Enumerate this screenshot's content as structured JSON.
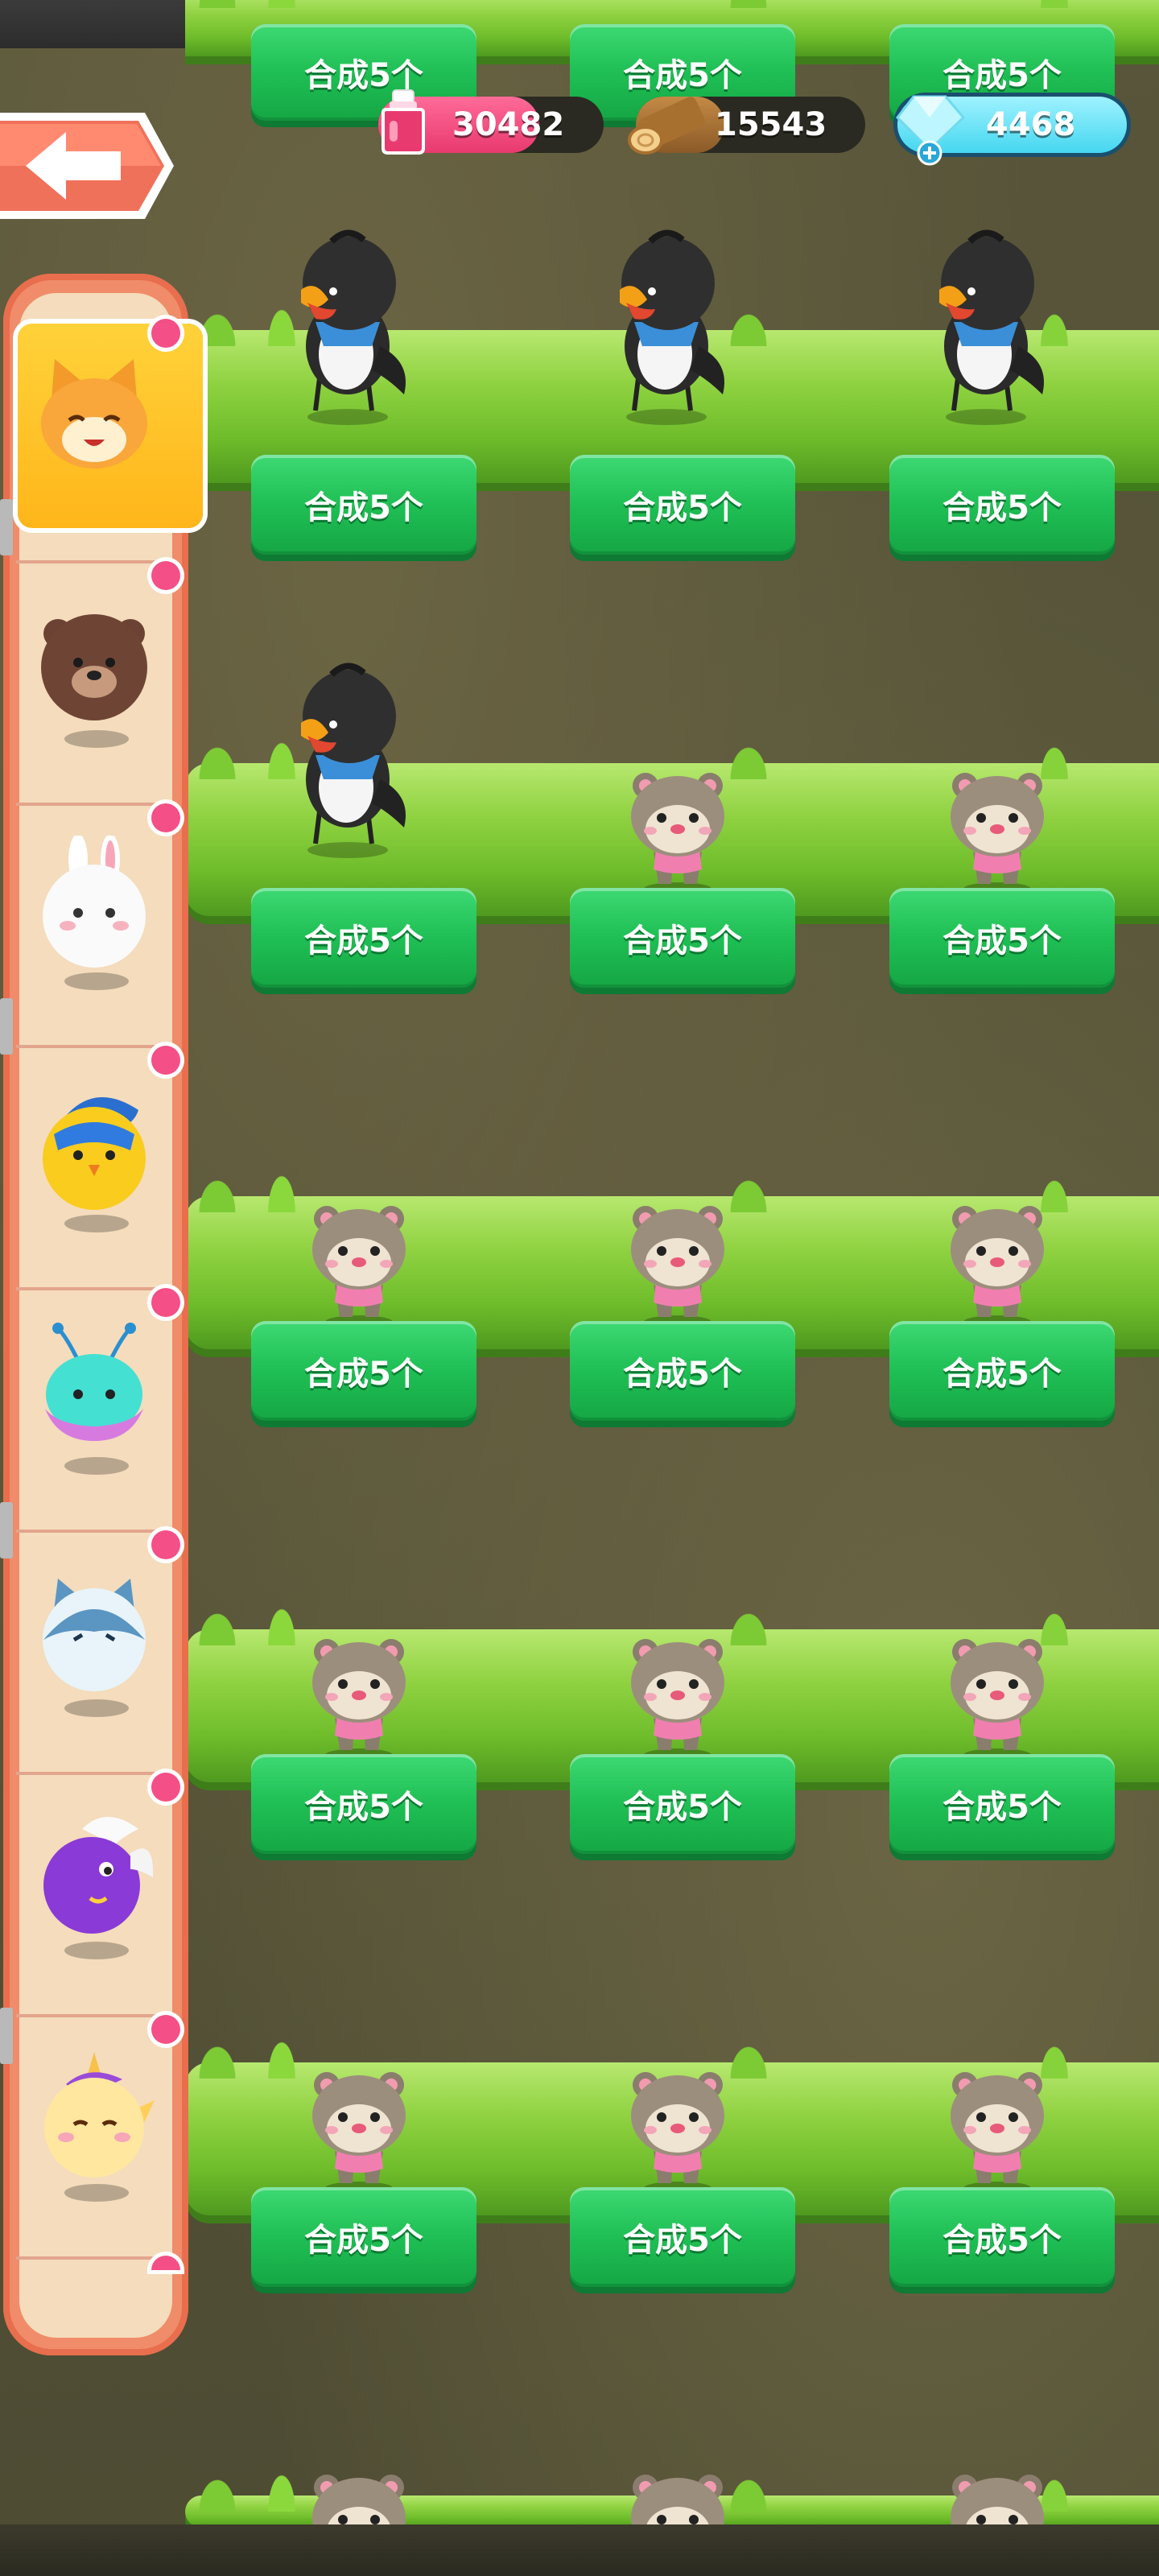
{
  "resources": {
    "potion": {
      "value": "30482",
      "icon": "potion-icon",
      "color": "#e83a6f"
    },
    "wood": {
      "value": "15543",
      "icon": "wood-log-icon",
      "color": "#9a6a33"
    },
    "gems": {
      "value": "4468",
      "icon": "gem-icon",
      "color": "#45d7f0"
    }
  },
  "merge_label": "合成5个",
  "grid": {
    "rows": [
      {
        "cells": [
          "magpie",
          "magpie",
          "magpie"
        ]
      },
      {
        "cells": [
          "magpie",
          "hamster",
          "hamster"
        ]
      },
      {
        "cells": [
          "hamster",
          "hamster",
          "hamster"
        ]
      },
      {
        "cells": [
          "hamster",
          "hamster",
          "hamster"
        ]
      },
      {
        "cells": [
          "hamster",
          "hamster",
          "hamster"
        ]
      },
      {
        "cells": [
          "hamster",
          "hamster",
          "hamster"
        ]
      }
    ]
  },
  "sidebar": {
    "items": [
      {
        "name": "cat-pet-icon",
        "selected": true,
        "badge": true
      },
      {
        "name": "bear-pet-icon",
        "selected": false,
        "badge": true
      },
      {
        "name": "rabbit-pet-icon",
        "selected": false,
        "badge": true
      },
      {
        "name": "bird-pet-icon",
        "selected": false,
        "badge": true
      },
      {
        "name": "alien-pet-icon",
        "selected": false,
        "badge": true
      },
      {
        "name": "shark-cat-pet-icon",
        "selected": false,
        "badge": true
      },
      {
        "name": "purple-pet-icon",
        "selected": false,
        "badge": true
      },
      {
        "name": "unicorn-pet-icon",
        "selected": false,
        "badge": true
      }
    ]
  },
  "colors": {
    "button_green": "#1fbf55",
    "grass": "#8fd241",
    "sidebar": "#f08c69",
    "badge": "#f44f86",
    "selected_slot": "#ffc52a"
  }
}
